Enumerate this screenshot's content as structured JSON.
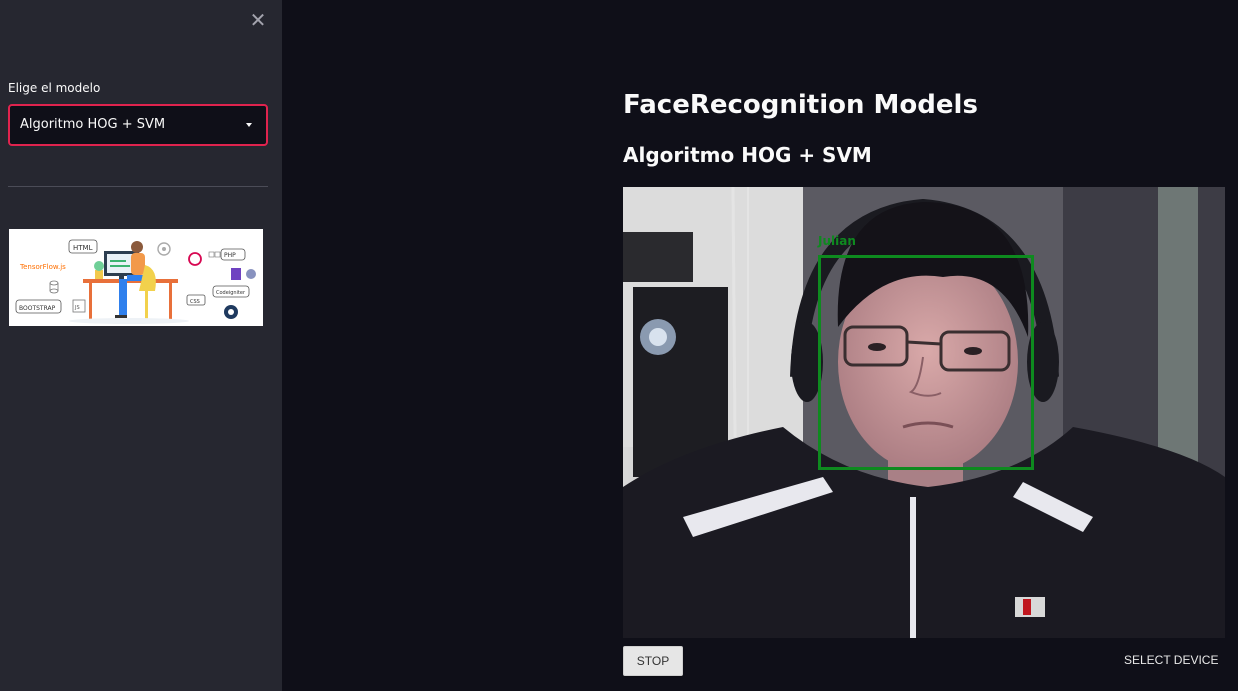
{
  "sidebar": {
    "close_icon": "close-icon",
    "select_label": "Elige el modelo",
    "select_value": "Algoritmo HOG + SVM",
    "illustration_labels": {
      "tensorflow": "TensorFlow.js",
      "html": "HTML",
      "php": "PHP",
      "bootstrap": "BOOTSTRAP",
      "css": "CSS",
      "codeigniter": "Codeigniter",
      "js": "JS"
    }
  },
  "main": {
    "title": "FaceRecognition Models",
    "subtitle": "Algoritmo HOG + SVM",
    "video": {
      "detected_name": "Julian"
    },
    "stop_label": "STOP",
    "select_device_label": "SELECT DEVICE"
  },
  "colors": {
    "background": "#0f0f18",
    "sidebar": "#262730",
    "select_border": "#e0234e",
    "face_box": "#0e8a1f"
  }
}
